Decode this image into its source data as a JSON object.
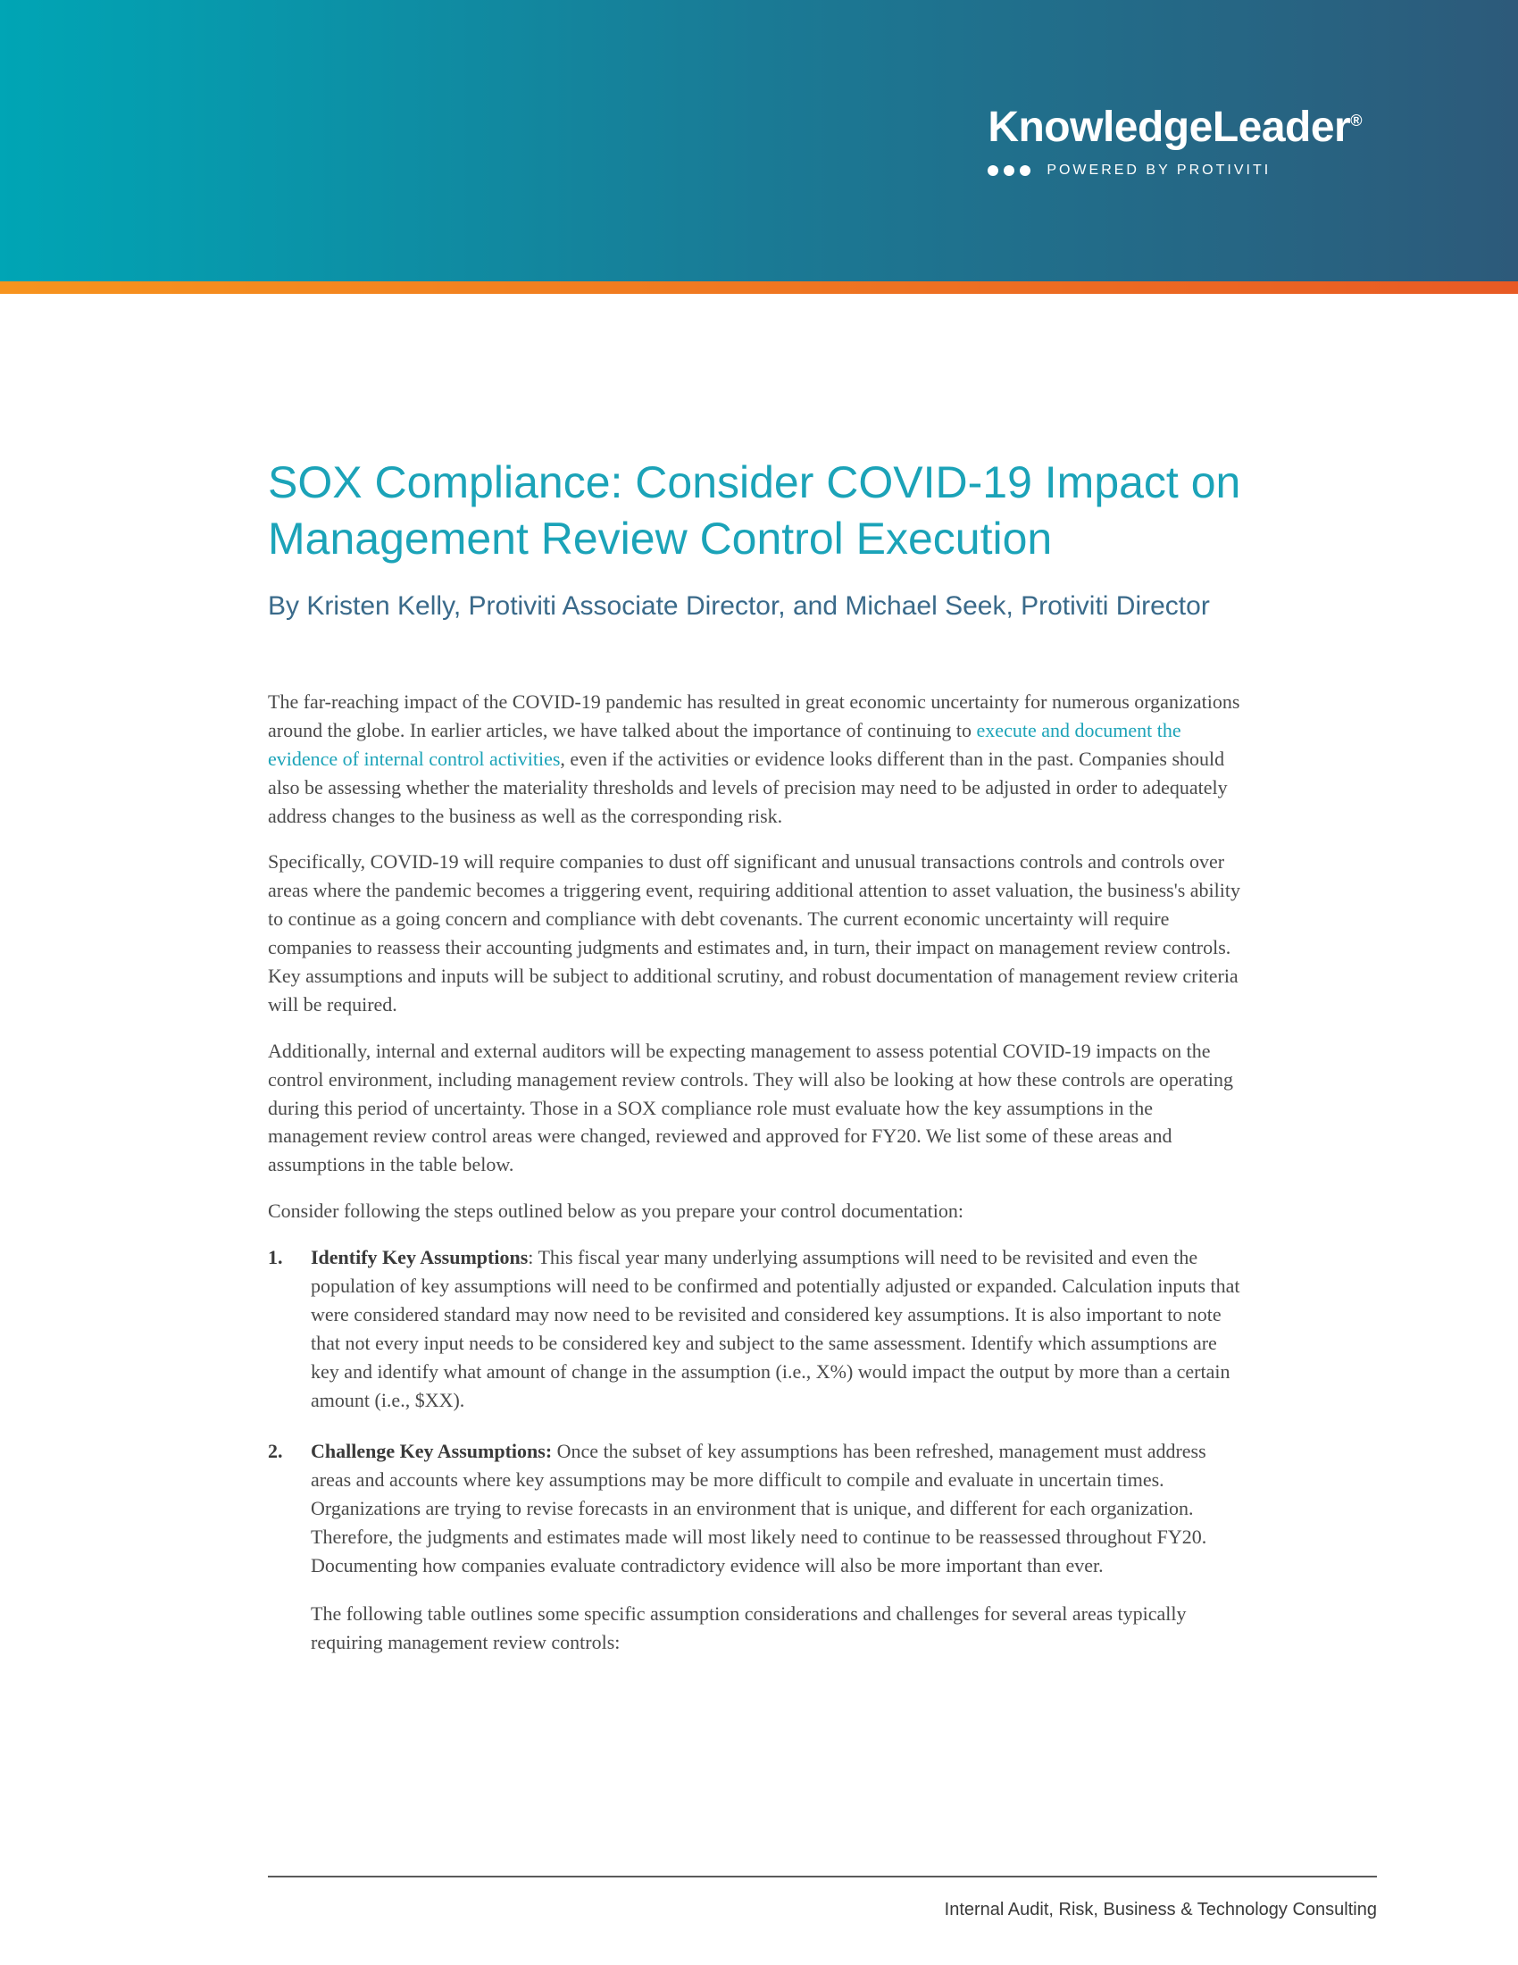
{
  "header": {
    "logo_main": "KnowledgeLeader",
    "logo_mark": "®",
    "powered_by": "POWERED BY PROTIVITI"
  },
  "article": {
    "title": "SOX Compliance: Consider COVID-19 Impact on Management Review Control Execution",
    "byline": "By Kristen Kelly, Protiviti Associate Director, and Michael Seek, Protiviti Director",
    "paragraphs": {
      "p1_pre": "The far-reaching impact of the COVID-19 pandemic has resulted in great economic uncertainty for numerous organizations around the globe. In earlier articles, we have talked about the importance of continuing to ",
      "p1_link": "execute and document the evidence of internal control activities",
      "p1_post": ", even if the activities or evidence looks different than in the past. Companies should also be assessing whether the materiality thresholds and levels of precision may need to be adjusted in order to adequately address changes to the business as well as the corresponding risk.",
      "p2": "Specifically, COVID-19 will require companies to dust off significant and unusual transactions controls and controls over areas where the pandemic becomes a triggering event, requiring additional attention to asset valuation, the business's ability to continue as a going concern and compliance with debt covenants. The current economic uncertainty will require companies to reassess their accounting judgments and estimates and, in turn, their impact on management review controls. Key assumptions and inputs will be subject to additional scrutiny, and robust documentation of management review criteria will be required.",
      "p3": "Additionally, internal and external auditors will be expecting management to assess potential COVID-19 impacts on the control environment, including management review controls. They will also be looking at how these controls are operating during this period of uncertainty. Those in a SOX compliance role must evaluate how the key assumptions in the management review control areas were changed, reviewed and approved for FY20. We list some of these areas and assumptions in the table below.",
      "p4": "Consider following the steps outlined below as you prepare your control documentation:"
    },
    "list": {
      "item1_heading": "Identify Key Assumptions",
      "item1_text": ": This fiscal year many underlying assumptions will need to be revisited and even the population of key assumptions will need to be confirmed and potentially adjusted or expanded. Calculation inputs that were considered standard may now need to be revisited and considered key assumptions. It is also important to note that not every input needs to be considered key and subject to the same assessment. Identify which assumptions are key and identify what amount of change in the assumption (i.e., X%) would impact the output by more than a certain amount (i.e., $XX).",
      "item2_heading": "Challenge Key Assumptions:",
      "item2_text": " Once the subset of key assumptions has been refreshed, management must address areas and accounts where key assumptions may be more difficult to compile and evaluate in uncertain times. Organizations are trying to revise forecasts in an environment that is unique, and different for each organization. Therefore, the judgments and estimates made will most likely need to continue to be reassessed throughout FY20. Documenting how companies evaluate contradictory evidence will also be more important than ever.",
      "item2_sub": "The following table outlines some specific assumption considerations and challenges for several areas typically requiring management review controls:"
    }
  },
  "footer": {
    "tagline": "Internal Audit, Risk, Business & Technology Consulting"
  }
}
